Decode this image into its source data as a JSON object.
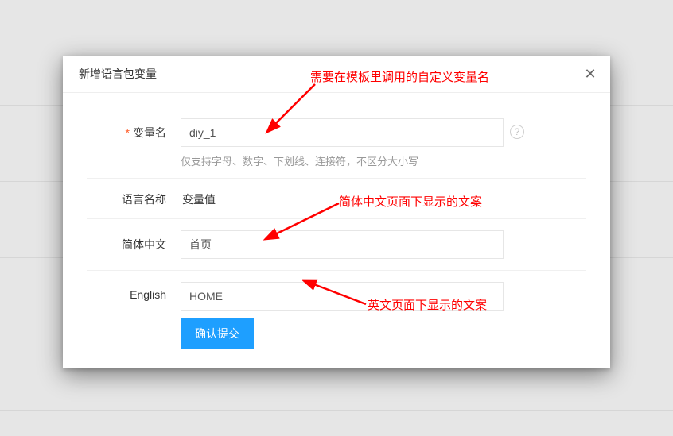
{
  "modal": {
    "title": "新增语言包变量"
  },
  "form": {
    "var_label": "变量名",
    "var_value": "diy_1",
    "var_hint": "仅支持字母、数字、下划线、连接符，不区分大小写",
    "col_lang_name": "语言名称",
    "col_var_value": "变量值",
    "rows": {
      "zh_label": "简体中文",
      "zh_value": "首页",
      "en_label": "English",
      "en_value": "HOME"
    },
    "submit_label": "确认提交"
  },
  "annotations": {
    "top": "需要在模板里调用的自定义变量名",
    "mid": "简体中文页面下显示的文案",
    "bottom": "英文页面下显示的文案"
  }
}
